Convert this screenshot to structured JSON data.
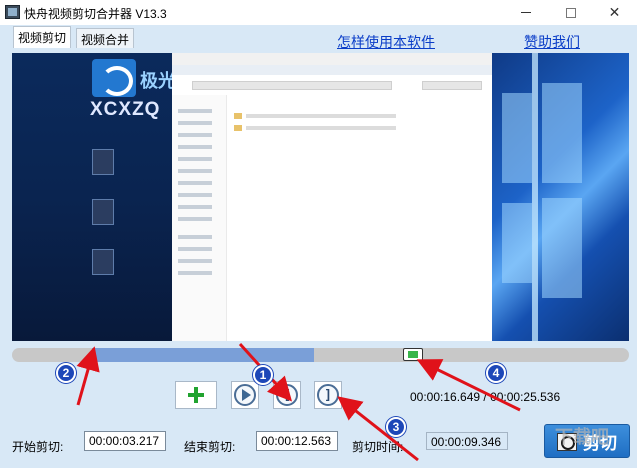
{
  "window": {
    "title": "快舟视频剪切合并器 V13.3",
    "minimize_glyph": "—",
    "maximize_glyph": "☐",
    "close_glyph": "✕"
  },
  "tabs": [
    {
      "label": "视频剪切",
      "active": true
    },
    {
      "label": "视频合并",
      "active": false
    }
  ],
  "links": {
    "how_to": "怎样使用本软件",
    "donate": "赞助我们"
  },
  "video_preview": {
    "logo_text": "极光",
    "site_text": "XCXZQ"
  },
  "timeline": {
    "selection_start_fraction": 0.13,
    "selection_end_fraction": 0.49,
    "playhead_fraction": 0.65
  },
  "controls": {
    "icons": [
      "plus-icon",
      "play-icon",
      "mark-start-icon",
      "mark-end-icon"
    ],
    "mark_start_glyph": "[",
    "mark_end_glyph": "]"
  },
  "time_readout": "00:00:16.649 / 00:00:25.536",
  "fields": {
    "start_label": "开始剪切:",
    "start_value": "00:00:03.217",
    "end_label": "结束剪切:",
    "end_value": "00:00:12.563",
    "duration_label": "剪切时间:",
    "duration_value": "00:00:09.346"
  },
  "cut_button": {
    "label": "剪切"
  },
  "annotations": {
    "badges": [
      "1",
      "2",
      "3",
      "4"
    ],
    "arrow_color": "#e0121a",
    "watermark": "下载吧"
  },
  "colors": {
    "panel_bg": "#d8e8f6",
    "accent": "#1f6ec3",
    "link": "#0a3dc8",
    "selection": "#7a9fd8"
  }
}
